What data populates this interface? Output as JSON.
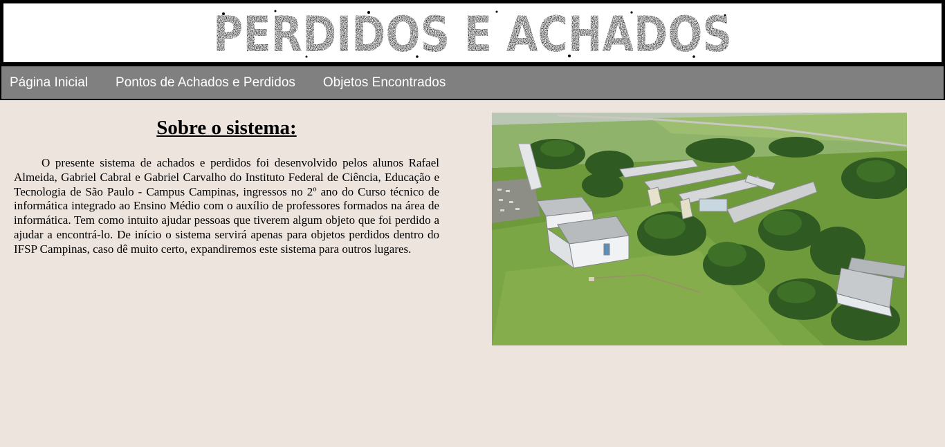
{
  "header": {
    "logo_text": "PERDIDOS E ACHADOS"
  },
  "nav": {
    "items": [
      {
        "label": "Página Inicial"
      },
      {
        "label": "Pontos de Achados e Perdidos"
      },
      {
        "label": "Objetos Encontrados"
      }
    ]
  },
  "about": {
    "title": "Sobre o sistema:",
    "text": "O presente sistema de achados e perdidos foi desenvolvido pelos alunos Rafael Almeida, Gabriel Cabral e Gabriel Carvalho do Instituto Federal de Ciência, Educação e Tecnologia de São Paulo - Campus Campinas, ingressos no 2º ano do Curso técnico de informática integrado ao Ensino Médio com o auxílio de professores formados na área de informática. Tem como intuito ajudar pessoas que tiverem algum objeto que foi perdido a ajudar a encontrá-lo. De início o sistema servirá apenas para objetos perdidos dentro do IFSP Campinas, caso dê muito certo, expandiremos este sistema para outros lugares."
  },
  "colors": {
    "page_background": "#ede4de",
    "nav_background": "#808080",
    "nav_text": "#ffffff",
    "banner_border": "#000000"
  }
}
